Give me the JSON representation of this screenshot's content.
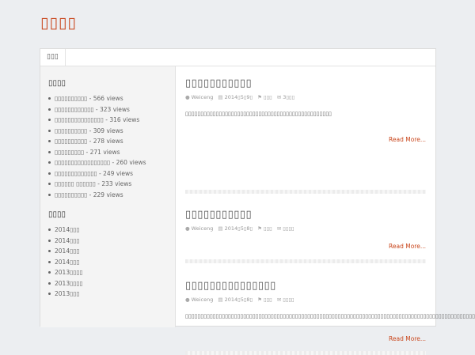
{
  "site": {
    "title": "▯▯▯▯"
  },
  "nav": {
    "items": [
      {
        "label": "▯▯▯"
      }
    ]
  },
  "sidebar": {
    "popular": {
      "title": "▯▯▯▯",
      "items": [
        "▯▯▯▯▯▯▯▯▯▯ - 566 views",
        "▯▯▯▯▯▯▯▯▯▯▯▯ - 323 views",
        "▯▯▯▯▯▯▯▯▯▯▯▯▯▯▯ - 316 views",
        "▯▯▯▯▯▯▯▯▯▯ - 309 views",
        "▯▯▯▯▯▯▯▯▯▯ - 278 views",
        "▯▯▯▯▯▯▯▯▯ - 271 views",
        "▯▯▯▯▯▯▯▯▯▯▯▯▯▯▯▯▯ - 260 views",
        "▯▯▯▯▯▯▯▯▯▯▯▯▯ - 249 views",
        "▯▯▯▯▯▯ ▯▯▯▯▯▯ - 233 views",
        "▯▯▯▯▯▯▯▯▯▯ - 229 views"
      ]
    },
    "archives": {
      "title": "▯▯▯▯",
      "items": [
        "2014▯▯▯",
        "2014▯▯▯",
        "2014▯▯▯",
        "2014▯▯▯",
        "2013▯▯▯▯",
        "2013▯▯▯▯",
        "2013▯▯▯"
      ]
    }
  },
  "posts": [
    {
      "title": "▯▯▯▯▯▯▯▯▯▯▯",
      "author": "Weiceng",
      "date": "2014▯5▯9▯",
      "category": "▯▯▯",
      "comments": "3▯▯▯",
      "excerpt": "▯▯▯▯▯▯▯▯▯▯▯▯▯▯▯▯▯▯▯▯▯▯▯▯▯▯▯▯▯▯▯▯▯▯▯▯▯▯▯▯▯▯▯▯▯▯▯▯",
      "read_more": "Read More..."
    },
    {
      "title": "▯▯▯▯▯▯▯▯▯▯▯",
      "author": "Weiceng",
      "date": "2014▯5▯8▯",
      "category": "▯▯▯",
      "comments": "▯▯▯▯",
      "excerpt": "",
      "read_more": "Read More..."
    },
    {
      "title": "▯▯▯▯▯▯▯▯▯▯▯▯▯▯▯",
      "author": "Weiceng",
      "date": "2014▯5▯8▯",
      "category": "▯▯▯",
      "comments": "▯▯▯▯",
      "excerpt": "▯▯▯▯▯▯▯▯▯▯▯▯▯▯▯▯▯▯▯▯▯▯▯▯▯▯▯▯▯▯▯▯▯▯▯▯▯▯▯▯▯▯▯▯▯▯▯▯▯▯▯▯▯▯▯▯▯▯▯▯▯▯▯▯▯▯▯▯▯▯▯▯▯▯▯▯▯▯▯▯▯▯▯▯▯▯▯▯▯▯▯▯▯▯▯▯▯",
      "read_more": "Read More..."
    }
  ],
  "colors": {
    "accent": "#c9461c",
    "background": "#eceef1",
    "sidebar": "#f4f4f4"
  },
  "icons": {
    "author": "user-icon",
    "date": "calendar-icon",
    "category": "tag-icon",
    "comments": "comment-icon"
  }
}
